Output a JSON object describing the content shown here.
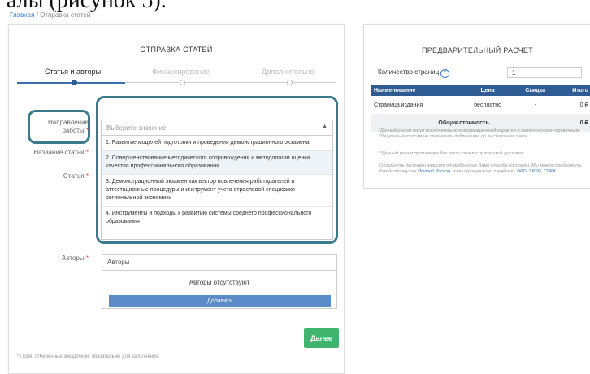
{
  "doc_header": "алы (рисунок 5).",
  "breadcrumb": {
    "home": "Главная",
    "sep": "/",
    "current": "Отправка статей"
  },
  "form": {
    "title": "ОТПРАВКА СТАТЕЙ",
    "steps": [
      {
        "label": "Статья и авторы",
        "state": "active"
      },
      {
        "label": "Финансирование",
        "state": "inactive"
      },
      {
        "label": "Дополнительно",
        "state": "inactive"
      }
    ],
    "direction_label_line1": "Направление",
    "direction_label_line2": "работы",
    "article_name_label": "Название статьи",
    "article_label": "Статья",
    "required_mark": "*",
    "select": {
      "placeholder": "Выберите значение",
      "caret": "▲",
      "options": [
        "1. Развитие моделей подготовки и проведения демонстрационного экзамена",
        "2. Совершенствование методического сопровождения и методологии оценки качества профессионального образования",
        "3. Демонстрационный экзамен как вектор вовлечения работодателей в аттестационные процедуры и инструмент учета отраслевой специфики региональной экономики",
        "4. Инструменты и подходы к развитию системы среднего профессионального образования"
      ]
    },
    "authors_label": "Авторы",
    "authors_box": {
      "header": "Авторы",
      "empty": "Авторы отсутствуют",
      "add_button": "Добавить"
    },
    "next_button": "Далее",
    "footnote": "* Поля, отмеченные звездочкой, обязательны для заполнения."
  },
  "estimate": {
    "title": "ПРЕДВАРИТЕЛЬНЫЙ РАСЧЕТ",
    "pages_label": "Количество страниц",
    "help_icon": "?",
    "pages_value": "1",
    "table": {
      "headers": [
        "Наименование",
        "Цена",
        "Скидка",
        "Итого"
      ],
      "row": [
        "Страница издания",
        "бесплатно",
        "-",
        "0 ₽"
      ],
      "total_label": "Общая стоимость",
      "total_value": "0 ₽"
    },
    "note1": "*Данный расчет носит исключительно информационный характер и является ориентировочным. Убедительно просим не оплачивать публикацию до выставления счета.",
    "note2": "**Данный расчет произведен без учета стоимости почтовой доставки!",
    "note3_prefix": "Стоимость доставки зависит от выбранных Вами способа доставки. Мы можем предложить Вам доставку как",
    "note3_post": "Почтой России",
    "note3_mid": ", так и курьерскими службами:",
    "note3_couriers": "DPD, SPSR, CDEK"
  },
  "colors": {
    "accent": "#2f5b93",
    "highlight": "#3b7a8c",
    "success": "#3eb46e",
    "required": "#e04a4a"
  }
}
